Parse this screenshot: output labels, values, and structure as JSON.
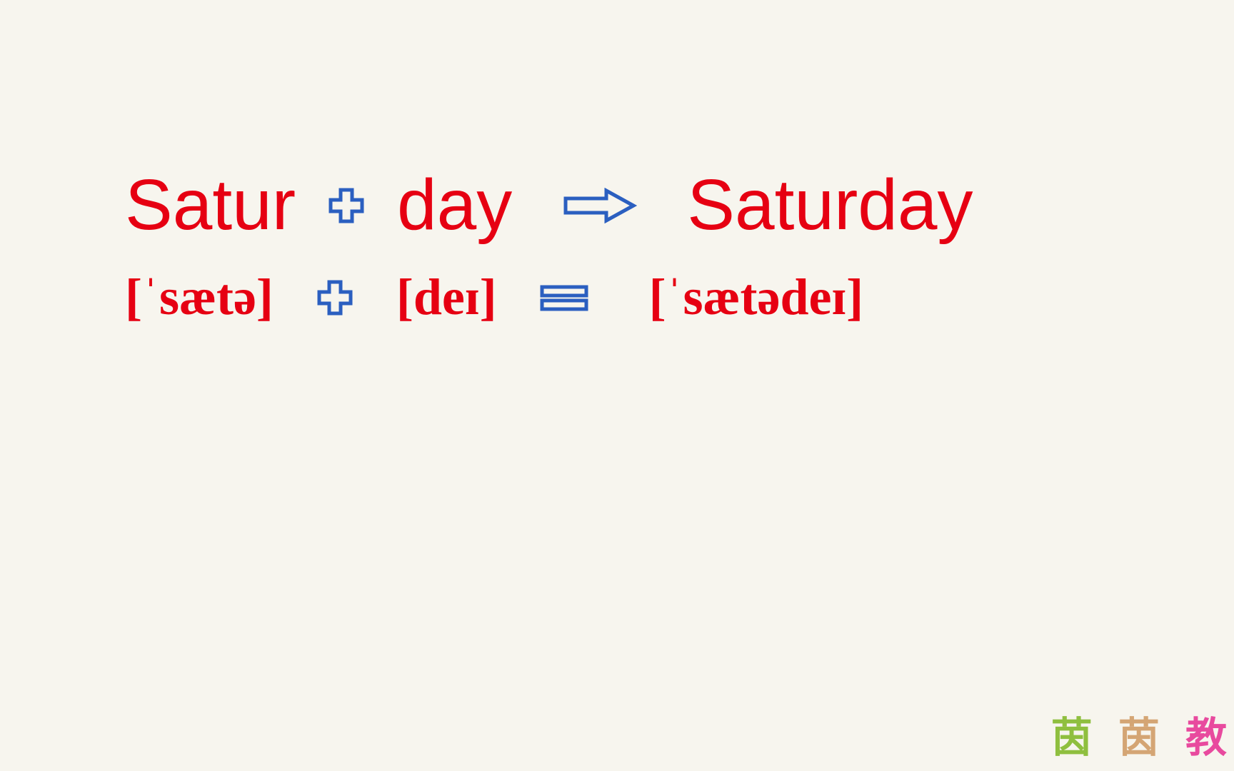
{
  "word_row": {
    "part1": "Satur",
    "part2": "day",
    "result": "Saturday"
  },
  "phonetic_row": {
    "part1": "[ˈsætə]",
    "part2": "[deɪ]",
    "result": "[ˈsætədeɪ]"
  },
  "watermark": {
    "char1": "茵",
    "char2": "茵",
    "char3": "教"
  }
}
